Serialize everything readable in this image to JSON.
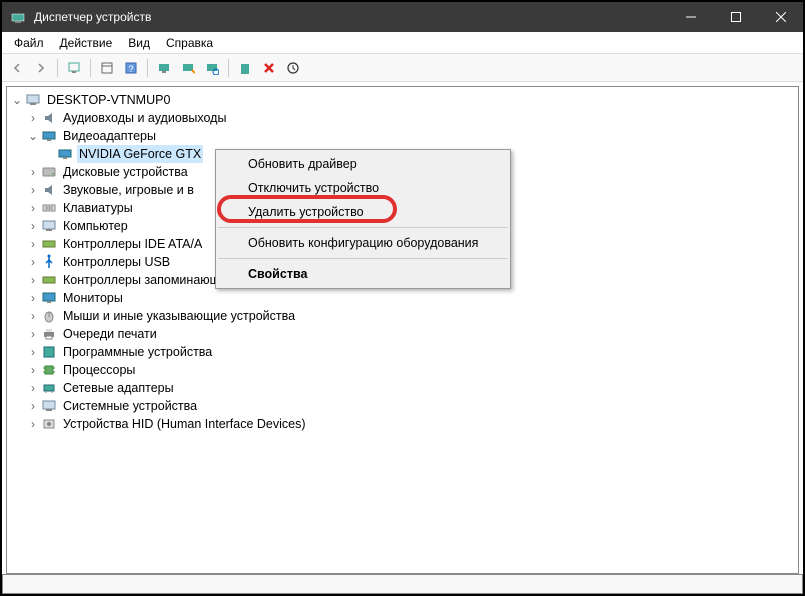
{
  "window": {
    "title": "Диспетчер устройств"
  },
  "menu": {
    "file": "Файл",
    "action": "Действие",
    "view": "Вид",
    "help": "Справка"
  },
  "tree": {
    "root": "DESKTOP-VTNMUP0",
    "audio": "Аудиовходы и аудиовыходы",
    "video": "Видеоадаптеры",
    "nvidia": "NVIDIA GeForce GTX",
    "disk": "Дисковые устройства",
    "sound": "Звуковые, игровые и в",
    "keyboard": "Клавиатуры",
    "computer": "Компьютер",
    "ide": "Контроллеры IDE ATA/A",
    "usb": "Контроллеры USB",
    "storage": "Контроллеры запоминающих устройств",
    "monitor": "Мониторы",
    "mouse": "Мыши и иные указывающие устройства",
    "print": "Очереди печати",
    "software": "Программные устройства",
    "cpu": "Процессоры",
    "network": "Сетевые адаптеры",
    "system": "Системные устройства",
    "hid": "Устройства HID (Human Interface Devices)"
  },
  "ctx": {
    "update": "Обновить драйвер",
    "disable": "Отключить устройство",
    "remove": "Удалить устройство",
    "scan": "Обновить конфигурацию оборудования",
    "props": "Свойства"
  }
}
